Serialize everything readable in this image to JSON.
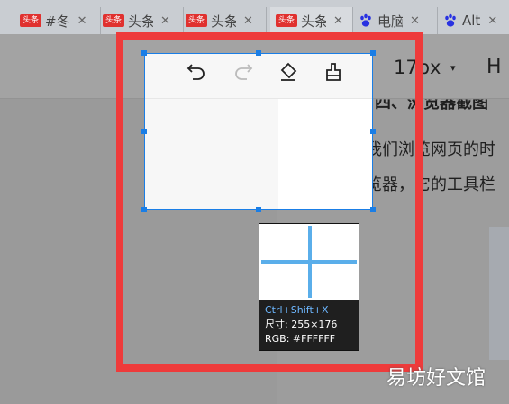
{
  "tabs": [
    {
      "badge": "头条",
      "title": "#冬",
      "active": false
    },
    {
      "badge": "头条",
      "title": "头条",
      "active": false
    },
    {
      "badge": "头条",
      "title": "头条",
      "active": false
    },
    {
      "badge": "头条",
      "title": "头条",
      "active": true
    },
    {
      "badge": "",
      "icon": "baidu-paw-icon",
      "title": "电脑",
      "active": false
    },
    {
      "badge": "",
      "icon": "baidu-paw-icon",
      "title": "Alt",
      "active": false
    }
  ],
  "editor_toolbar": {
    "font_size": "17px",
    "heading": "H"
  },
  "background_text": {
    "heading_fragment": "四、浏览器截图",
    "line1": "在我们浏览网页的时",
    "line2": "浏览器，它的工具栏"
  },
  "capture_tools": {
    "undo": "undo-icon",
    "redo": "redo-icon",
    "eraser": "eraser-icon",
    "brush": "brush-icon"
  },
  "magnifier": {
    "shortcut": "Ctrl+Shift+X",
    "size_label": "尺寸",
    "size_value": "255×176",
    "rgb_label": "RGB",
    "rgb_value": "#FFFFFF"
  },
  "watermark": "易坊好文馆",
  "colors": {
    "selection_border": "#1a7ee6",
    "annotation_red": "#ee3b3b",
    "crosshair": "#5aaeea"
  }
}
